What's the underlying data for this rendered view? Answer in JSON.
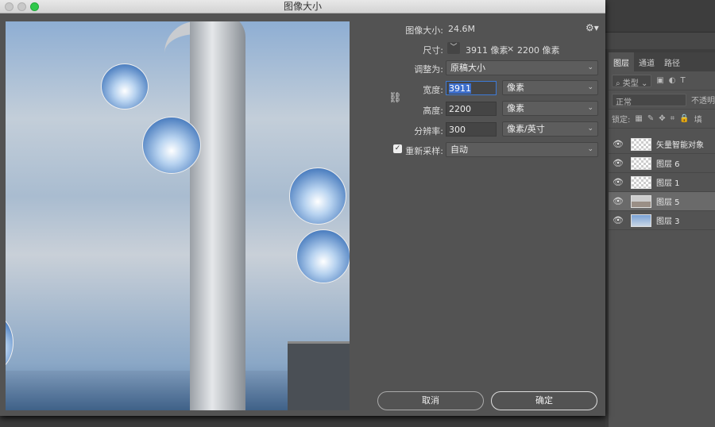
{
  "dialog": {
    "title": "图像大小",
    "image_size_label": "图像大小:",
    "image_size_value": "24.6M",
    "dimensions_label": "尺寸:",
    "dim_width": "3911 像素",
    "dim_times": "×",
    "dim_height": "2200 像素",
    "fit_to_label": "调整为:",
    "fit_to_value": "原稿大小",
    "width_label": "宽度:",
    "width_value": "3911",
    "width_unit": "像素",
    "height_label": "高度:",
    "height_value": "2200",
    "height_unit": "像素",
    "resolution_label": "分辨率:",
    "resolution_value": "300",
    "resolution_unit": "像素/英寸",
    "resample_label": "重新采样:",
    "resample_checked": true,
    "resample_value": "自动",
    "cancel": "取消",
    "ok": "确定"
  },
  "layers_panel": {
    "tabs": [
      "图层",
      "通道",
      "路径"
    ],
    "filter": "类型",
    "blend_mode": "正常",
    "opacity_label": "不透明",
    "lock_label": "锁定:",
    "fill_label": "填",
    "layers": [
      {
        "name": "矢量智能对象",
        "selected": false
      },
      {
        "name": "图层 6",
        "selected": false
      },
      {
        "name": "图层 1",
        "selected": false
      },
      {
        "name": "图层 5",
        "selected": true
      },
      {
        "name": "图层 3",
        "selected": false
      }
    ]
  }
}
